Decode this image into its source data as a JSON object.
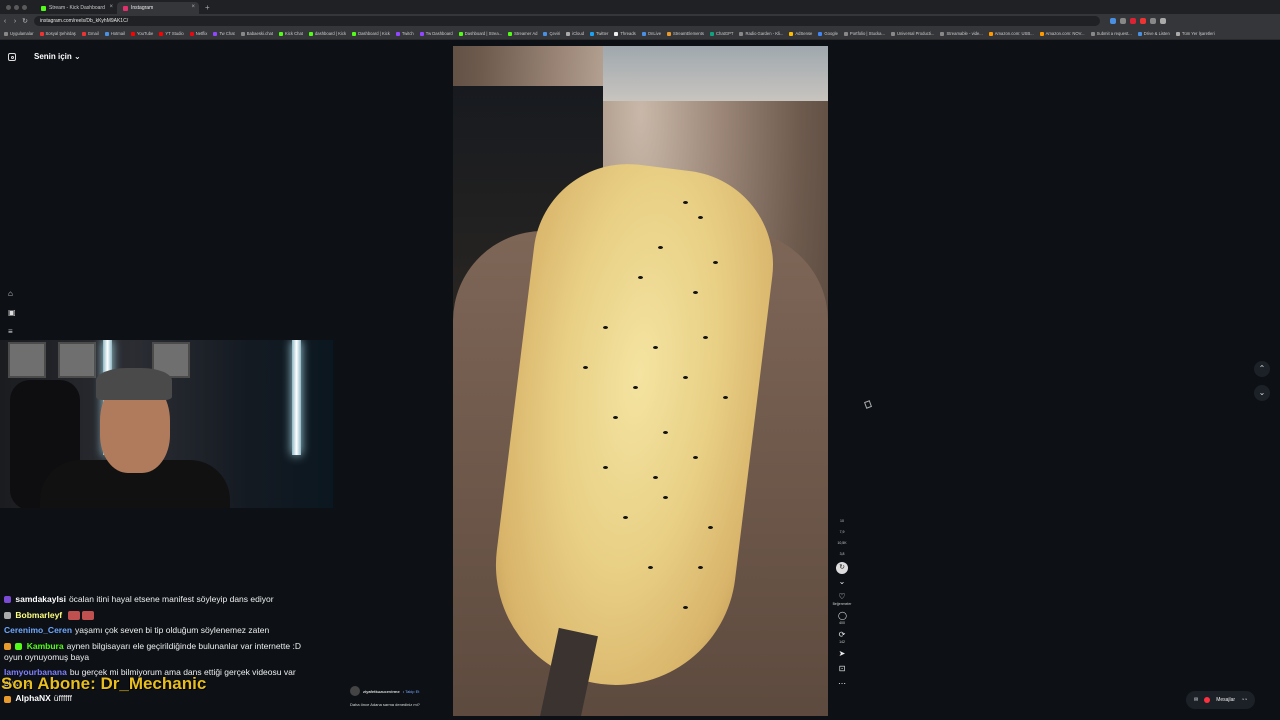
{
  "browser": {
    "tabs": [
      {
        "title": "Stream - Kick Dashboard",
        "active": false,
        "color": "#53fc18"
      },
      {
        "title": "Instagram",
        "active": true,
        "color": "#e1306c"
      }
    ],
    "new_tab": "+",
    "url": "instagram.com/reels/Db_kKyhM9AK1C/",
    "bookmarks": [
      "Uygulamalar",
      "Sosyal Şehirdaş",
      "Gmail",
      "Hotmail",
      "YouTube",
      "YT Studio",
      "Netflix",
      "Tw Chat",
      "Babaeski.chat",
      "Kick Chat",
      "dashboard | Kick",
      "Dashboard | Kick",
      "Twitch",
      "Tw Dashboard",
      "Dashboard | Strea...",
      "Streamer Ad",
      "Çeviri",
      "iCloud",
      "Twitter",
      "Threads",
      "OnLive",
      "StreamElements",
      "ChatGPT",
      "Radio Garden - Kli...",
      "AdSense",
      "Google",
      "Portfolio | Stucka...",
      "Universal Producti...",
      "Streamable - vide...",
      "Amazon.com: USB...",
      "Amazon.com: NOV...",
      "Submit a request...",
      "Drive & Listen",
      "Tüm Yer İşaretleri"
    ]
  },
  "instagram": {
    "header_title": "Senin için",
    "chevron": "⌄"
  },
  "reel": {
    "actions": [
      {
        "icon": "♡",
        "label": "Beğenmeler"
      },
      {
        "icon": "◯",
        "label": "400"
      },
      {
        "icon": "⟳",
        "label": "142"
      },
      {
        "icon": "➤",
        "label": ""
      },
      {
        "icon": "⊡",
        "label": ""
      },
      {
        "icon": "⋯",
        "label": ""
      }
    ],
    "top_counts": {
      "a": "10",
      "b": "7,9",
      "c": "10,5K",
      "d": "3,8"
    },
    "caption_user": "ziyafetkuzucevirme",
    "caption_follow": "• Takip Et",
    "caption_text": "Daha önce Adana sarma denediniz mi?"
  },
  "messages_label": "Mesajlar",
  "chat": [
    {
      "user": "samdakaylsi",
      "color": "#ffffff",
      "text": "öcalan itini hayal etsene manifest söyleyip dans ediyor"
    },
    {
      "user": "Bobmarleyf",
      "color": "#ffff80",
      "text": ""
    },
    {
      "user": "Cerenimo_Ceren",
      "color": "#6fa8ff",
      "text": "yaşamı çok seven bi tip olduğum söylenemez zaten"
    },
    {
      "user": "Kambura",
      "color": "#53fc18",
      "text": "aynen bilgisayarı ele geçirildiğinde bulunanlar var internette :D oyun oynuyomuş baya"
    },
    {
      "user": "Iamyourbanana",
      "color": "#7f7fff",
      "text": "bu gerçek mi bilmiyorum ama dans ettiği gerçek videosu var bu tarz"
    },
    {
      "user": "AlphaNX",
      "color": "#ffffff",
      "text": "üffffff"
    }
  ],
  "last_sub": "Son Abone: Dr_Mechanic"
}
